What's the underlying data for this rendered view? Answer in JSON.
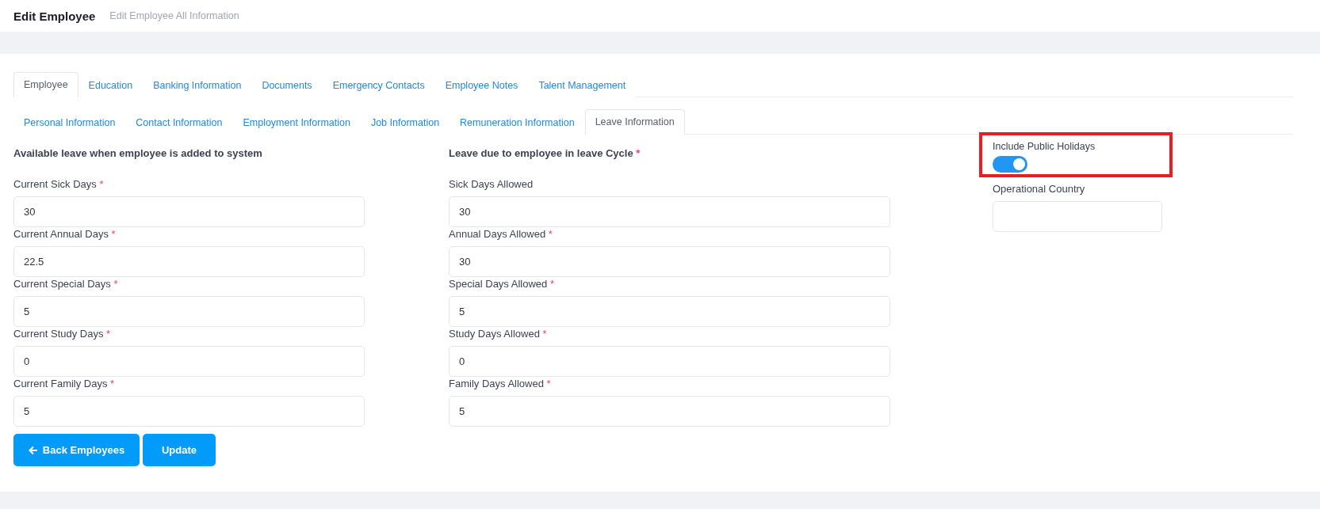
{
  "header": {
    "title": "Edit Employee",
    "subtitle": "Edit Employee All Information"
  },
  "tabs": [
    {
      "label": "Employee",
      "selected": true
    },
    {
      "label": "Education",
      "selected": false
    },
    {
      "label": "Banking Information",
      "selected": false
    },
    {
      "label": "Documents",
      "selected": false
    },
    {
      "label": "Emergency Contacts",
      "selected": false
    },
    {
      "label": "Employee Notes",
      "selected": false
    },
    {
      "label": "Talent Management",
      "selected": false
    }
  ],
  "subtabs": [
    {
      "label": "Personal Information",
      "selected": false
    },
    {
      "label": "Contact Information",
      "selected": false
    },
    {
      "label": "Employment Information",
      "selected": false
    },
    {
      "label": "Job Information",
      "selected": false
    },
    {
      "label": "Remuneration Information",
      "selected": false
    },
    {
      "label": "Leave Information",
      "selected": true
    }
  ],
  "sections": [
    {
      "heading": "Available leave when employee is added to system",
      "fields": [
        {
          "label": "Current Sick Days",
          "required_mark": "*",
          "value": "30"
        },
        {
          "label": "Current Annual Days",
          "required_mark": "*",
          "value": "22.5"
        },
        {
          "label": "Current Special Days",
          "required_mark": "*",
          "value": "5"
        },
        {
          "label": "Current Study Days",
          "required_mark": "*",
          "value": "0"
        },
        {
          "label": "Current Family Days",
          "required_mark": "*",
          "value": "5"
        }
      ]
    },
    {
      "heading": "Leave due to employee in leave Cycle",
      "required_mark": "*",
      "fields": [
        {
          "label": "Sick Days Allowed",
          "value": "30"
        },
        {
          "label": "Annual Days Allowed",
          "required_mark": "*",
          "value": "30"
        },
        {
          "label": "Special Days Allowed",
          "required_mark": "*",
          "value": "5"
        },
        {
          "label": "Study Days Allowed",
          "required_mark": "*",
          "value": "0"
        },
        {
          "label": "Family Days Allowed",
          "required_mark": "*",
          "value": "5"
        }
      ]
    }
  ],
  "settings": {
    "toggle": {
      "label": "Include Public Holidays",
      "on": true,
      "highlighted": true
    },
    "field": {
      "label": "Operational Country"
    }
  },
  "buttons": [
    {
      "label": "Back Employees",
      "kind": "back"
    },
    {
      "label": "Update",
      "kind": "primary"
    }
  ]
}
